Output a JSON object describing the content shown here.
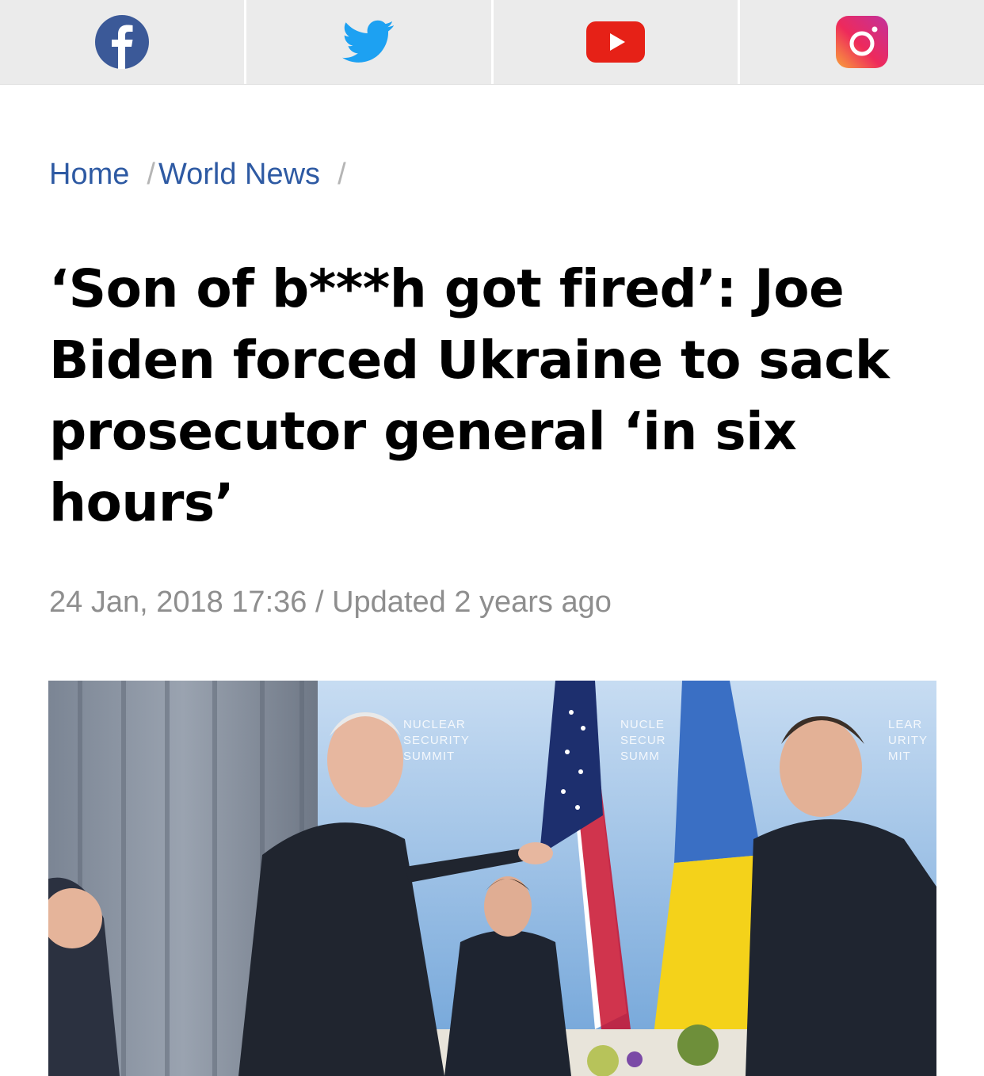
{
  "social": {
    "items": [
      {
        "name": "facebook",
        "icon": "facebook-icon",
        "color": "#3b5998"
      },
      {
        "name": "twitter",
        "icon": "twitter-icon",
        "color": "#1da1f2"
      },
      {
        "name": "youtube",
        "icon": "youtube-icon",
        "color": "#e62117"
      },
      {
        "name": "instagram",
        "icon": "instagram-icon",
        "color": "#e1306c"
      }
    ]
  },
  "breadcrumb": {
    "home": "Home",
    "section": "World News",
    "separator": "/"
  },
  "article": {
    "headline": "‘Son of b***h got fired’: Joe Biden forced Ukraine to sack prosecutor general ‘in six hours’",
    "date": "24 Jan, 2018 17:36",
    "meta_separator": " / ",
    "updated": "Updated 2 years ago"
  },
  "hero_image": {
    "backdrop_text": [
      "NUCLEAR",
      "SECURITY",
      "SUMMIT"
    ],
    "backdrop_text_2": [
      "NUCLE",
      "SECUR",
      "SUMM"
    ],
    "backdrop_text_3": [
      "LEAR",
      "URITY",
      "MIT"
    ]
  }
}
